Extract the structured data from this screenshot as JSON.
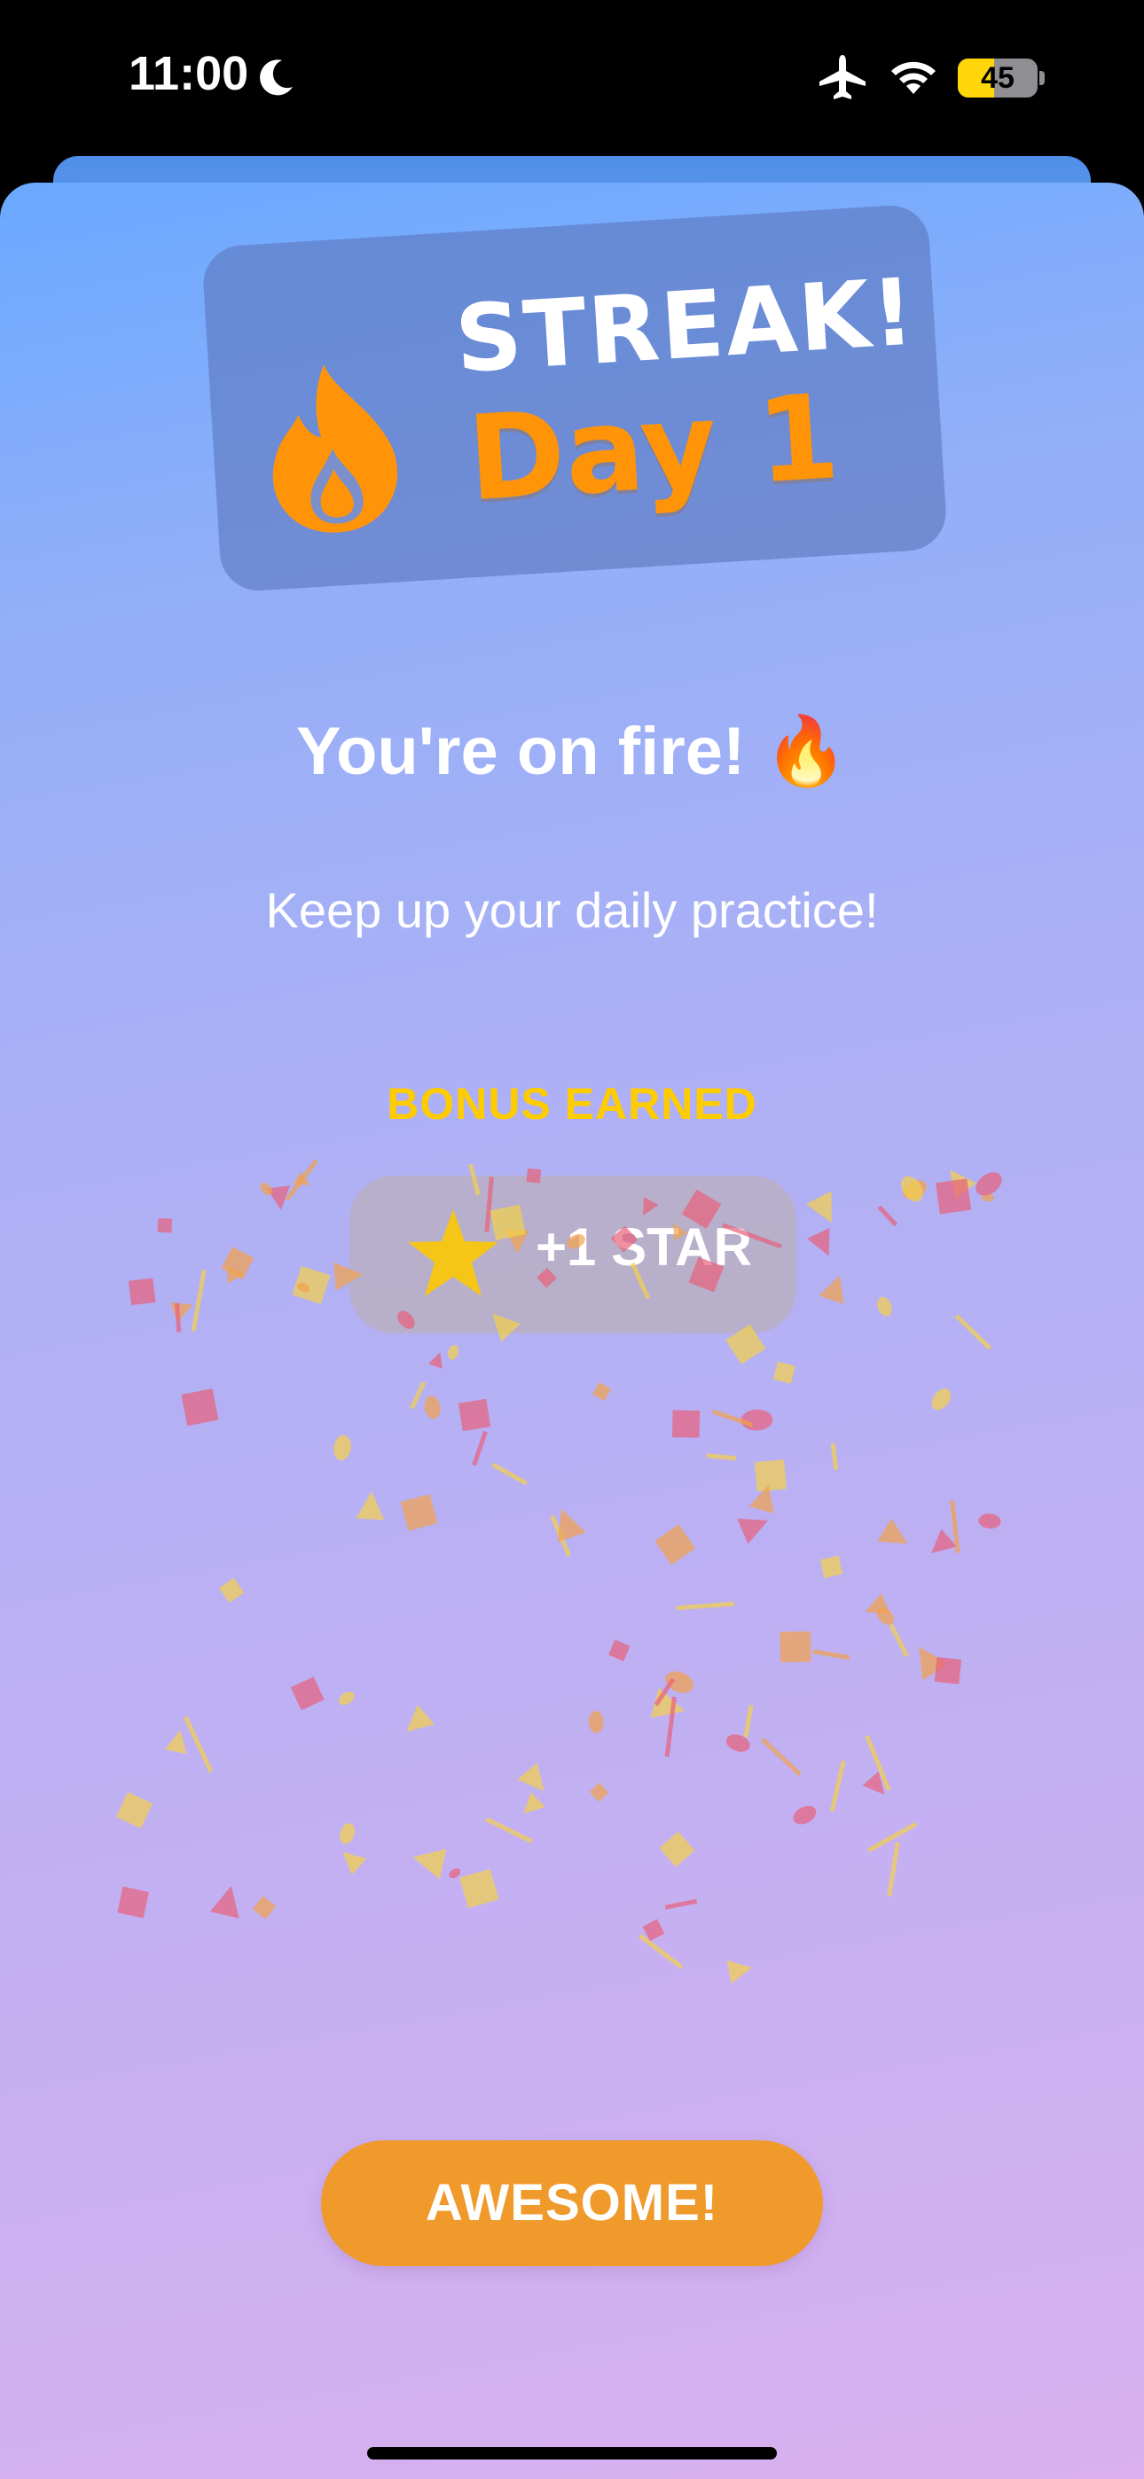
{
  "status_bar": {
    "time": "11:00",
    "battery_level": 45,
    "battery_label": "45",
    "icons": [
      "moon-icon",
      "airplane-icon",
      "wifi-icon",
      "battery-charging-icon"
    ]
  },
  "streak": {
    "title": "STREAK!",
    "day_label": "Day 1",
    "icon": "flame-icon"
  },
  "headline": "You're on fire! 🔥",
  "subtitle": "Keep up your daily practice!",
  "bonus": {
    "label": "BONUS EARNED",
    "value": "+1 STAR",
    "icon": "star-icon"
  },
  "actions": {
    "confirm_label": "AWESOME!"
  },
  "colors": {
    "accent_orange": "#f09a2c",
    "streak_orange": "#ff9408",
    "bonus_gold": "#ffcc00",
    "confetti_red": "#e8617a",
    "confetti_orange": "#f2a24a",
    "confetti_yellow": "#f3d24a"
  }
}
